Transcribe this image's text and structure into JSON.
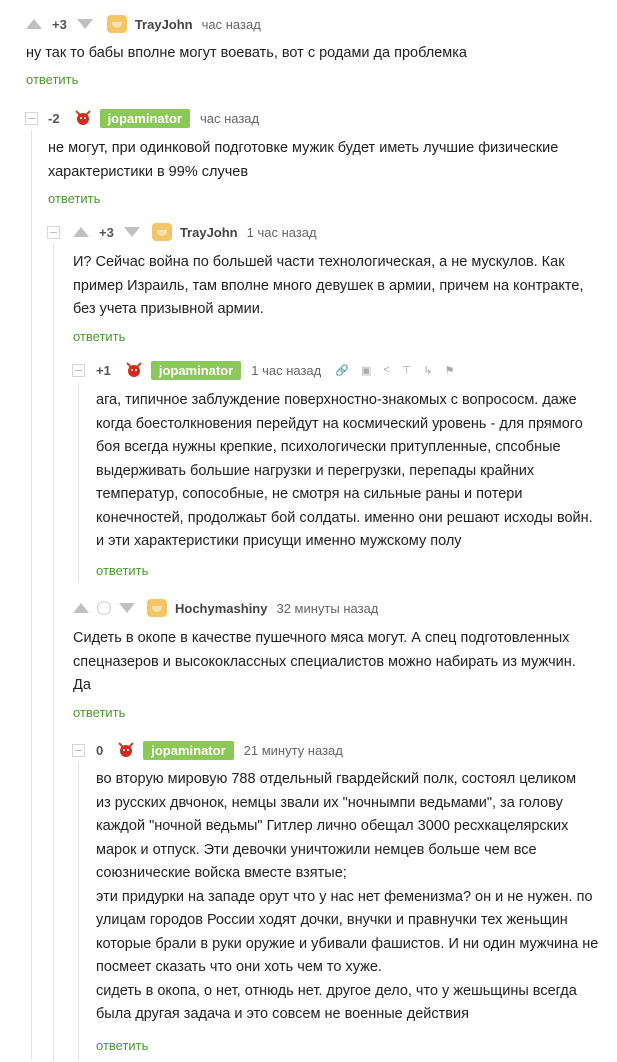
{
  "comments": [
    {
      "rating": "+3",
      "author": "TrayJohn",
      "time": "час назад",
      "text": "ну так то бабы вполне могут воевать, вот с родами да проблемка",
      "reply": "ответить"
    },
    {
      "rating": "-2",
      "author": "jopaminator",
      "time": "час назад",
      "lines": [
        "не могут, при одинковой подготовке мужик будет иметь лучшие физические",
        "характеристики в 99% случев"
      ],
      "reply": "ответить"
    },
    {
      "rating": "+3",
      "author": "TrayJohn",
      "time": "1 час назад",
      "lines": [
        "И? Сейчас война по большей части технологическая, а не мускулов. Как",
        "пример Израиль, там вполне много девушек в армии, причем на контракте,",
        "без учета призывной армии."
      ],
      "reply": "ответить"
    },
    {
      "rating": "+1",
      "author": "jopaminator",
      "time": "1 час назад",
      "lines": [
        "ага, типичное заблуждение поверхностно-знакомых с вопрососм. даже",
        "когда боестолкновения перейдут на космический уровень - для прямого",
        "боя всегда нужны крепкие, психологически притупленные, спсобные",
        "выдерживать большие нагрузки и перегрузки, перепады крайних",
        "температур, сопособные, не смотря на сильные раны и потери",
        "конечностей, продолжаьт бой солдаты. именно они решают исходы войн.",
        "и эти характеристики присущи именно мужскому полу"
      ],
      "reply": "ответить"
    },
    {
      "author": "Hochymashiny",
      "time": "32 минуты назад",
      "lines": [
        "Сидеть в окопе в качестве пушечного мяса могут. А спец подготовленных",
        "спецназеров и высококлассных специалистов можно набирать из мужчин.",
        "Да"
      ],
      "reply": "ответить"
    },
    {
      "rating": "0",
      "author": "jopaminator",
      "time": "21 минуту назад",
      "lines": [
        "во вторую мировую 788 отдельный гвардейский полк, состоял целиком",
        "из русских двчонок, немцы звали их \"ночнымпи ведьмами\", за голову",
        "каждой \"ночной ведьмы\" Гитлер лично обещал 3000 ресхкацелярских",
        "марок и отпуск. Эти девочки уничтожили немцев больше чем все",
        "союзнические войска вместе взятые;",
        "эти придурки на западе орут что у нас нет феменизма? он и не нужен. по",
        "улицам городов России ходят дочки, внучки и правнучки тех женьщин",
        "которые брали в руки оружие и убивали фашистов. И ни один мужчина не",
        "посмеет сказать что они хоть чем то хуже.",
        "сидеть в окопа, о нет, отнюдь нет. другое дело, что у жешьщины всегда",
        "была другая задача и это совсем не военные действия"
      ],
      "reply": "ответить"
    }
  ],
  "colors": {
    "badge": "#8ac858",
    "reply": "#4a9a2c"
  }
}
